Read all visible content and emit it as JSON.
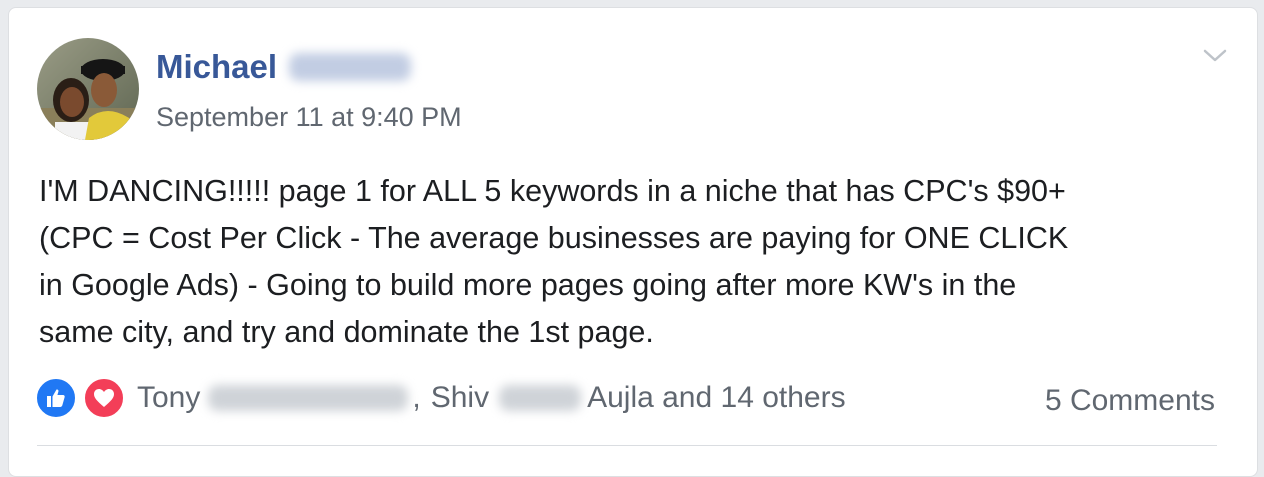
{
  "post": {
    "author_first": "Michael",
    "timestamp": "September 11 at 9:40 PM",
    "text_lines": [
      "I'M DANCING!!!!! page 1 for ALL 5 keywords in a niche that has CPC's $90+",
      "(CPC = Cost Per Click - The average businesses are paying for ONE CLICK",
      "in Google Ads) - Going to build more pages going after more KW's in the",
      "same city, and try and dominate the 1st page."
    ]
  },
  "reactions": {
    "icons": [
      "like-icon",
      "love-icon"
    ],
    "name1_first": "Tony",
    "separator": ",",
    "name2_first": "Shiv",
    "tail": "Aujla and 14 others"
  },
  "comments_label": "5 Comments",
  "colors": {
    "author_link": "#385898",
    "like": "#2078f4",
    "love": "#f33e58",
    "meta_text": "#606770",
    "body_text": "#1c1e21"
  }
}
